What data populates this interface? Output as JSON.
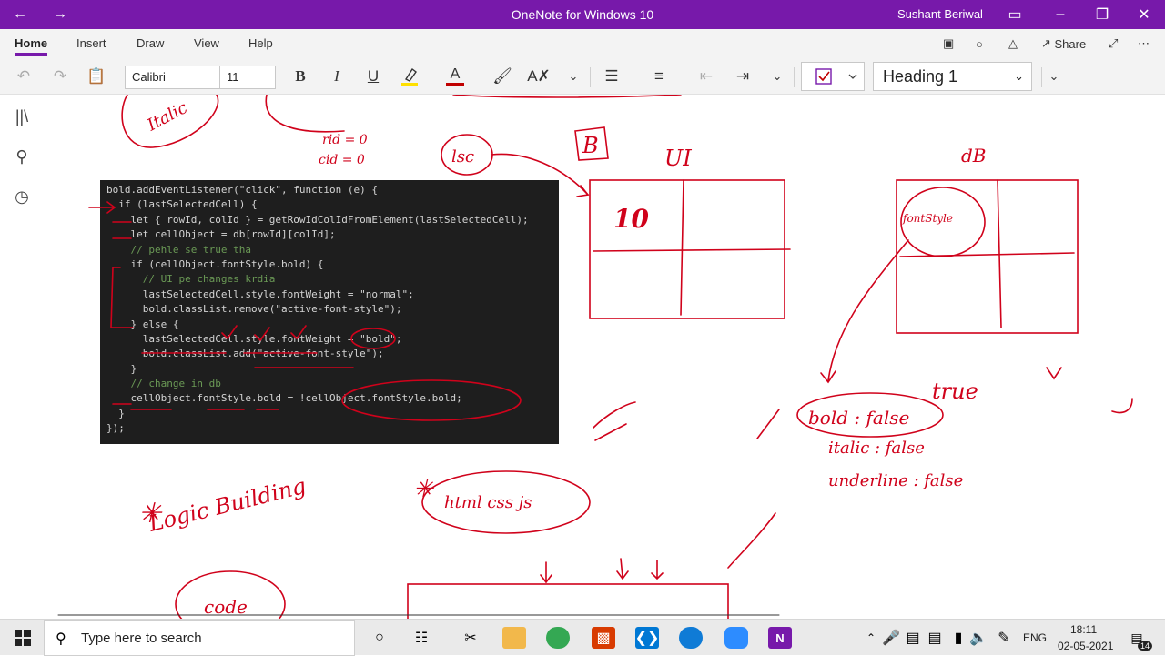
{
  "titlebar": {
    "app_title": "OneNote for Windows 10",
    "user": "Sushant Beriwal",
    "back_icon": "arrow-left-icon",
    "forward_icon": "arrow-right-icon"
  },
  "tabs": [
    {
      "label": "Home"
    },
    {
      "label": "Insert"
    },
    {
      "label": "Draw"
    },
    {
      "label": "View"
    },
    {
      "label": "Help"
    }
  ],
  "share_label": "Share",
  "ribbon": {
    "font_name": "Calibri",
    "font_size": "11",
    "style": "Heading 1",
    "bold": "B",
    "italic": "I",
    "underline": "U",
    "font_color": "A",
    "highlight_color": "#ffe000",
    "font_color_bar": "#c00000"
  },
  "code_lines": [
    "bold.addEventListener(\"click\", function (e) {",
    "  if (lastSelectedCell) {",
    "    let { rowId, colId } = getRowIdColIdFromElement(lastSelectedCell);",
    "    let cellObject = db[rowId][colId];",
    "    // pehle se true tha",
    "    if (cellObject.fontStyle.bold) {",
    "      // UI pe changes krdia",
    "      lastSelectedCell.style.fontWeight = \"normal\";",
    "      bold.classList.remove(\"active-font-style\");",
    "    } else {",
    "      lastSelectedCell.style.fontWeight = \"bold\";",
    "      bold.classList.add(\"active-font-style\");",
    "    }",
    "    // change in db",
    "    cellObject.fontStyle.bold = !cellObject.fontStyle.bold;",
    "  }",
    "});"
  ],
  "ink": {
    "color": "#d0021b",
    "texts": [
      {
        "text": "10"
      },
      {
        "text": "B"
      },
      {
        "text": "UI"
      },
      {
        "text": "dB"
      },
      {
        "text": "lsc"
      },
      {
        "text": "fontStyle"
      },
      {
        "text": "true"
      },
      {
        "text": "bold : false"
      },
      {
        "text": "italic : false"
      },
      {
        "text": "underline : false"
      },
      {
        "text": "Logic Building"
      },
      {
        "text": "html css js"
      },
      {
        "text": "code"
      },
      {
        "text": "Italic"
      },
      {
        "text": "rid = 0"
      },
      {
        "text": "cid = 0"
      }
    ]
  },
  "taskbar": {
    "search_placeholder": "Type here to search",
    "lang": "ENG",
    "time": "18:11",
    "date": "02-05-2021",
    "notifications": "14"
  }
}
